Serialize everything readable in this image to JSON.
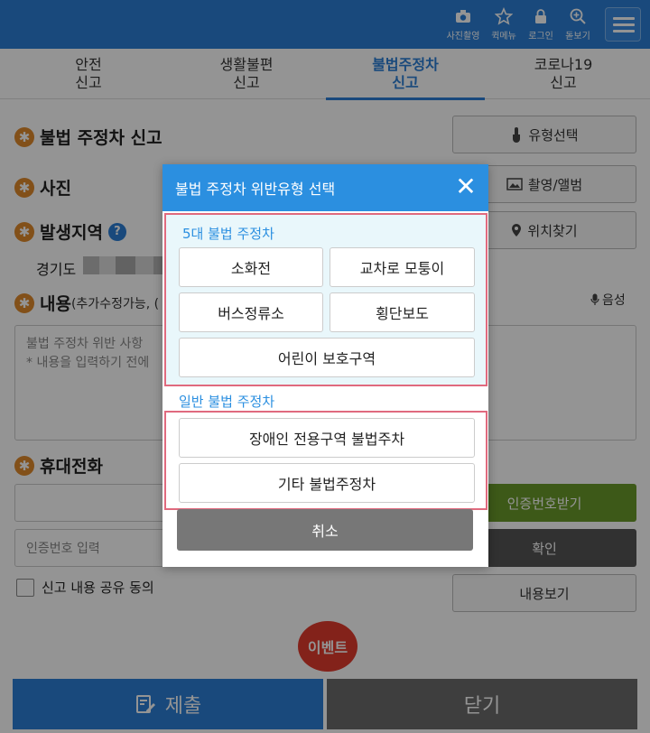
{
  "header": {
    "icons": [
      {
        "name": "camera-icon",
        "label": "사진촬영"
      },
      {
        "name": "star-icon",
        "label": "퀵메뉴"
      },
      {
        "name": "lock-icon",
        "label": "로그인"
      },
      {
        "name": "zoom-icon",
        "label": "돋보기"
      }
    ]
  },
  "tabs": [
    {
      "line1": "안전",
      "line2": "신고"
    },
    {
      "line1": "생활불편",
      "line2": "신고"
    },
    {
      "line1": "불법주정차",
      "line2": "신고"
    },
    {
      "line1": "코로나19",
      "line2": "신고"
    }
  ],
  "form": {
    "report_title": "불법 주정차 신고",
    "type_select_button": "유형선택",
    "photo_title": "사진",
    "photo_button": "촬영/앨범",
    "region_title": "발생지역",
    "help_badge": "?",
    "location_button": "위치찾기",
    "region_value": "경기도",
    "content_title": "내용",
    "content_title_extra": "(추가수정가능, (",
    "voice_label": "음성",
    "content_placeholder_line1": "불법 주정차 위반 사항",
    "content_placeholder_line2": "* 내용을 입력하기 전에",
    "phone_title": "휴대전화",
    "verify_placeholder": "인증번호 입력",
    "get_code_button": "인증번호받기",
    "confirm_button": "확인",
    "consent_label": "신고 내용 공유 동의",
    "view_content_button": "내용보기"
  },
  "event_button": "이벤트",
  "bottom": {
    "submit": "제출",
    "close": "닫기"
  },
  "modal": {
    "title": "불법 주정차 위반유형 선택",
    "close_symbol": "✕",
    "group_main_title": "5대 불법 주정차",
    "group_main_options": [
      "소화전",
      "교차로 모퉁이",
      "버스정류소",
      "횡단보도",
      "어린이 보호구역"
    ],
    "group_general_title": "일반 불법 주정차",
    "group_general_options": [
      "장애인 전용구역 불법주차",
      "기타 불법주정차"
    ],
    "cancel": "취소"
  },
  "colors": {
    "primary": "#2b7fd6",
    "modal_header": "#2b8fe0",
    "highlight_border": "#e06a7e",
    "event_red": "#e23b2e",
    "green": "#6a9a2a"
  }
}
